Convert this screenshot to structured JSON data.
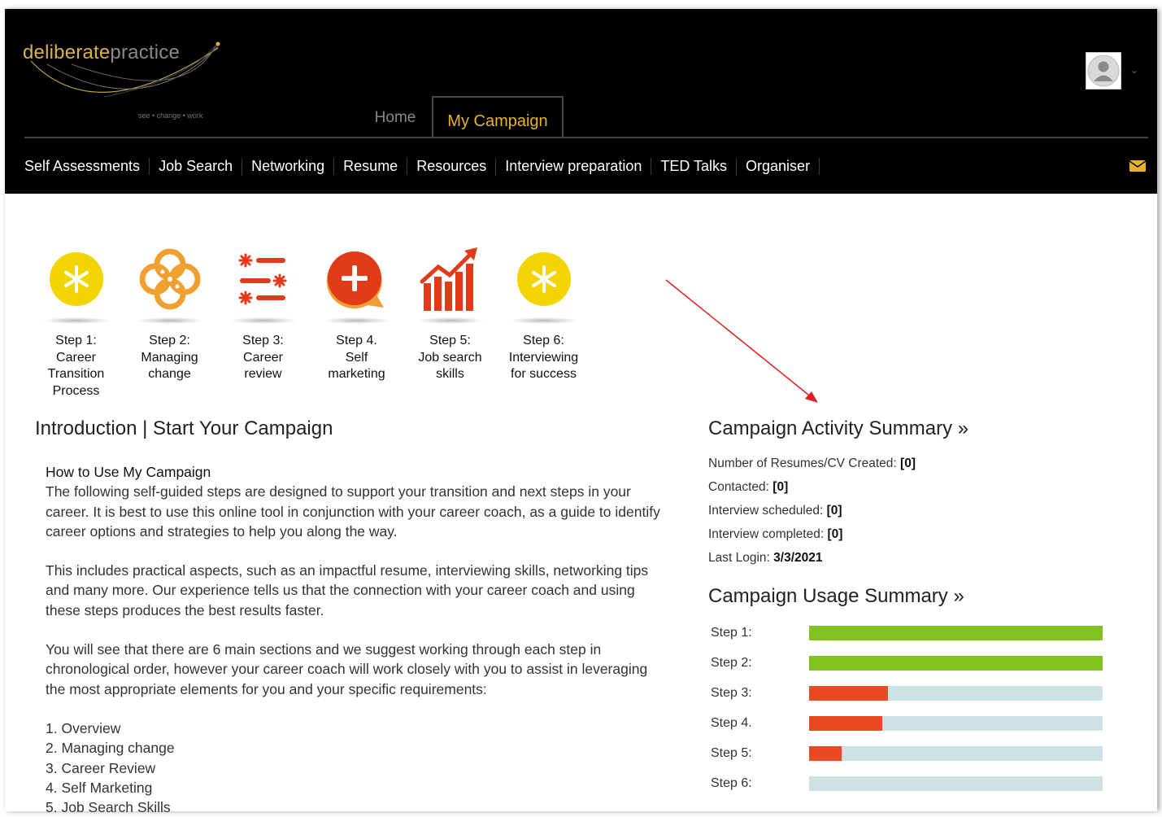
{
  "logo": {
    "part1": "deliberate",
    "part2": "practice",
    "tagline": "see • change • work"
  },
  "tabs": [
    {
      "label": "Home"
    },
    {
      "label": "My Campaign"
    }
  ],
  "subnav": [
    "Self Assessments",
    "Job Search",
    "Networking",
    "Resume",
    "Resources",
    "Interview preparation",
    "TED Talks",
    "Organiser"
  ],
  "icons": {
    "avatar": "user-avatar-icon",
    "mail": "envelope-icon"
  },
  "colors": {
    "accent": "#e8b32a",
    "step_yellow": "#f2d500",
    "step_orange": "#f0a030",
    "step_red": "#e23b1a",
    "bar_green": "#7fc31c",
    "bar_red": "#e84a22",
    "bar_track": "#cde3e3"
  },
  "steps": [
    {
      "lines": [
        "Step 1:",
        "Career",
        "Transition",
        "Process"
      ],
      "icon": "asterisk-circle-icon"
    },
    {
      "lines": [
        "Step 2:",
        "Managing",
        "change"
      ],
      "icon": "links-icon"
    },
    {
      "lines": [
        "Step 3:",
        "Career",
        "review"
      ],
      "icon": "checklist-icon"
    },
    {
      "lines": [
        "Step 4.",
        "Self",
        "marketing"
      ],
      "icon": "plus-bubble-icon"
    },
    {
      "lines": [
        "Step 5:",
        "Job search",
        "skills"
      ],
      "icon": "growth-chart-icon"
    },
    {
      "lines": [
        "Step 6:",
        "Interviewing",
        "for success"
      ],
      "icon": "asterisk-circle-icon"
    }
  ],
  "intro": {
    "title": "Introduction | Start Your Campaign",
    "heading": "How to Use My Campaign",
    "p1": "The following self-guided steps are designed to support your transition and next steps in your career. It is best to use this online tool in conjunction with your career coach, as a guide to identify career options and strategies to help you along the way.",
    "p2": "This includes practical aspects, such as an impactful resume, interviewing skills, networking tips and many more. Our experience tells us that the connection with your career coach and using these steps produces the best results faster.",
    "p3": "You will see that there are 6 main sections and we suggest working through each step in chronological order, however your career coach will work closely with you to assist in leveraging the most appropriate elements for you and your specific requirements:",
    "list": [
      "1. Overview",
      "2. Managing change",
      "3. Career Review",
      "4. Self Marketing",
      "5. Job Search Skills"
    ]
  },
  "activity": {
    "title": "Campaign Activity Summary »",
    "rows": [
      {
        "label": "Number of Resumes/CV Created:",
        "value": "[0]"
      },
      {
        "label": "Contacted:",
        "value": "[0]"
      },
      {
        "label": "Interview scheduled:",
        "value": "[0]"
      },
      {
        "label": "Interview completed:",
        "value": "[0]"
      },
      {
        "label": "Last Login:",
        "value": "3/3/2021"
      }
    ]
  },
  "usage": {
    "title": "Campaign Usage Summary »",
    "steps": [
      {
        "label": "Step 1:",
        "progress": 1.0,
        "status": "complete"
      },
      {
        "label": "Step 2:",
        "progress": 1.0,
        "status": "complete"
      },
      {
        "label": "Step 3:",
        "progress": 0.27,
        "status": "partial"
      },
      {
        "label": "Step 4.",
        "progress": 0.25,
        "status": "partial"
      },
      {
        "label": "Step 5:",
        "progress": 0.11,
        "status": "partial"
      },
      {
        "label": "Step 6:",
        "progress": 0.0,
        "status": "none"
      }
    ]
  }
}
